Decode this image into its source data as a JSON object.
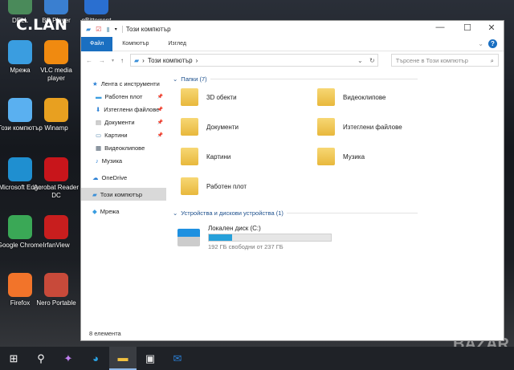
{
  "watermark": "C.LAN",
  "corner_logo": "BAZAR",
  "desktop": [
    {
      "label": "DELL",
      "color": "#4a8a5a"
    },
    {
      "label": "BS.Player",
      "color": "#3a7fd0"
    },
    {
      "label": "qBittorrent",
      "color": "#2a6fd0"
    },
    {
      "label": "Мрежа",
      "color": "#3a9de0"
    },
    {
      "label": "VLC media player",
      "color": "#f08a10"
    },
    {
      "label": "Този компютър",
      "color": "#5ab0f0"
    },
    {
      "label": "Winamp",
      "color": "#e8a020"
    },
    {
      "label": "Microsoft Edge",
      "color": "#1f8fd0"
    },
    {
      "label": "Acrobat Reader DC",
      "color": "#c8151b"
    },
    {
      "label": "Google Chrome",
      "color": "#3aa856"
    },
    {
      "label": "IrfanView",
      "color": "#c81e1e"
    },
    {
      "label": "Firefox",
      "color": "#f2742a"
    },
    {
      "label": "Nero Portable",
      "color": "#c84a3a"
    }
  ],
  "window": {
    "title": "Този компютър",
    "controls": {
      "minimize": "—",
      "maximize": "☐",
      "close": "✕"
    },
    "ribbon_tabs": [
      "Файл",
      "Компютър",
      "Изглед"
    ],
    "address": {
      "path": "Този компютър",
      "search_placeholder": "Търсене в Този компютър"
    },
    "nav": [
      {
        "label": "Лента с инструменти",
        "icon": "star-icon",
        "top": true
      },
      {
        "label": "Работен плот",
        "icon": "desktop-icon",
        "pinned": true
      },
      {
        "label": "Изтеглени файлове",
        "icon": "download-icon",
        "pinned": true
      },
      {
        "label": "Документи",
        "icon": "document-icon",
        "pinned": true
      },
      {
        "label": "Картини",
        "icon": "pictures-icon",
        "pinned": true
      },
      {
        "label": "Видеоклипове",
        "icon": "video-icon"
      },
      {
        "label": "Музика",
        "icon": "music-icon"
      },
      {
        "label": "OneDrive",
        "icon": "cloud-icon",
        "top": true
      },
      {
        "label": "Този компютър",
        "icon": "computer-icon",
        "top": true,
        "selected": true
      },
      {
        "label": "Мрежа",
        "icon": "network-icon",
        "top": true
      }
    ],
    "folders_header": "Папки (7)",
    "folders": [
      "3D обекти",
      "Видеоклипове",
      "Документи",
      "Изтеглени файлове",
      "Картини",
      "Музика",
      "Работен плот"
    ],
    "devices_header": "Устройства и дискови устройства (1)",
    "disk": {
      "name": "Локален диск (C:)",
      "free_text": "192 ГБ свободни от 237 ГБ",
      "used_percent": 19,
      "bar_color": "#26a0da"
    },
    "status": "8 елемента"
  },
  "taskbar": [
    "windows-start-icon",
    "search-icon",
    "copilot-icon",
    "edge-icon",
    "file-explorer-icon",
    "store-icon",
    "outlook-icon"
  ]
}
